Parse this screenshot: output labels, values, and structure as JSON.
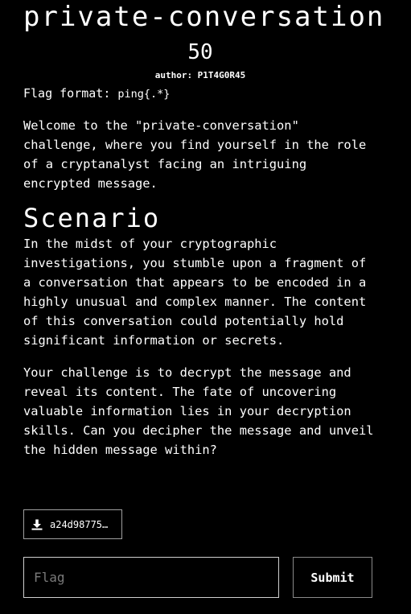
{
  "challenge": {
    "title": "private-conversation",
    "points": "50",
    "author": "author: P1T4G0R45",
    "flag_format_label": "Flag format: ",
    "flag_format_value": "ping{.*}"
  },
  "description": {
    "intro": "Welcome to the \"private-conversation\" challenge, where you find yourself in the role of a cryptanalyst facing an intriguing encrypted message.",
    "scenario_heading": "Scenario",
    "scenario_p1": "In the midst of your cryptographic investigations, you stumble upon a fragment of a conversation that appears to be encoded in a highly unusual and complex manner. The content of this conversation could potentially hold significant information or secrets.",
    "scenario_p2": "Your challenge is to decrypt the message and reveal its content. The fate of uncovering valuable information lies in your decryption skills. Can you decipher the message and unveil the hidden message within?"
  },
  "attachment": {
    "icon": "download-icon",
    "label": "a24d98775…"
  },
  "submission": {
    "placeholder": "Flag",
    "value": "",
    "submit_label": "Submit"
  }
}
